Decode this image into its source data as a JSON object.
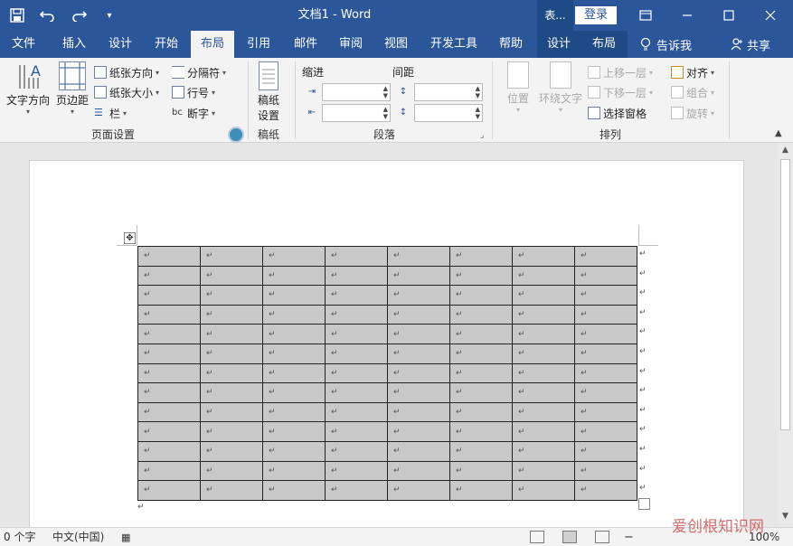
{
  "titlebar": {
    "title": "文档1  -  Word",
    "context_title": "表...",
    "login_label": "登录",
    "qat_icons": [
      "save-icon",
      "undo-icon",
      "redo-icon",
      "customize-qat-icon"
    ]
  },
  "tabs": [
    {
      "label": "文件"
    },
    {
      "label": "插入"
    },
    {
      "label": "设计"
    },
    {
      "label": "开始"
    },
    {
      "label": "布局",
      "active": true
    },
    {
      "label": "引用"
    },
    {
      "label": "邮件"
    },
    {
      "label": "审阅"
    },
    {
      "label": "视图"
    },
    {
      "label": "开发工具"
    },
    {
      "label": "帮助"
    },
    {
      "label": "设计"
    },
    {
      "label": "布局"
    }
  ],
  "tell_me": "告诉我",
  "share": "共享",
  "ribbon": {
    "page_setup": {
      "label": "页面设置",
      "text_direction": "文字方向",
      "margins": "页边距",
      "orientation": "纸张方向",
      "size": "纸张大小",
      "columns": "栏",
      "breaks": "分隔符",
      "line_numbers": "行号",
      "hyphenation": "断字"
    },
    "manuscript": {
      "label": "稿纸",
      "setup_line1": "稿纸",
      "setup_line2": "设置"
    },
    "paragraph": {
      "label": "段落",
      "indent_title": "缩进",
      "spacing_title": "间距",
      "indent_left": "",
      "indent_right": "",
      "spacing_before": "",
      "spacing_after": ""
    },
    "arrange": {
      "label": "排列",
      "position": "位置",
      "wrap_text": "环绕文字",
      "bring_forward": "上移一层",
      "send_backward": "下移一层",
      "selection_pane": "选择窗格",
      "align": "对齐",
      "group": "组合",
      "rotate": "旋转"
    }
  },
  "document": {
    "table": {
      "rows": 13,
      "cols": 8,
      "cell_mark": "↵"
    },
    "end_mark": "↵"
  },
  "statusbar": {
    "word_count": "0 个字",
    "language": "中文(中国)",
    "zoom": "100%"
  },
  "watermark": "爱创根知识网"
}
